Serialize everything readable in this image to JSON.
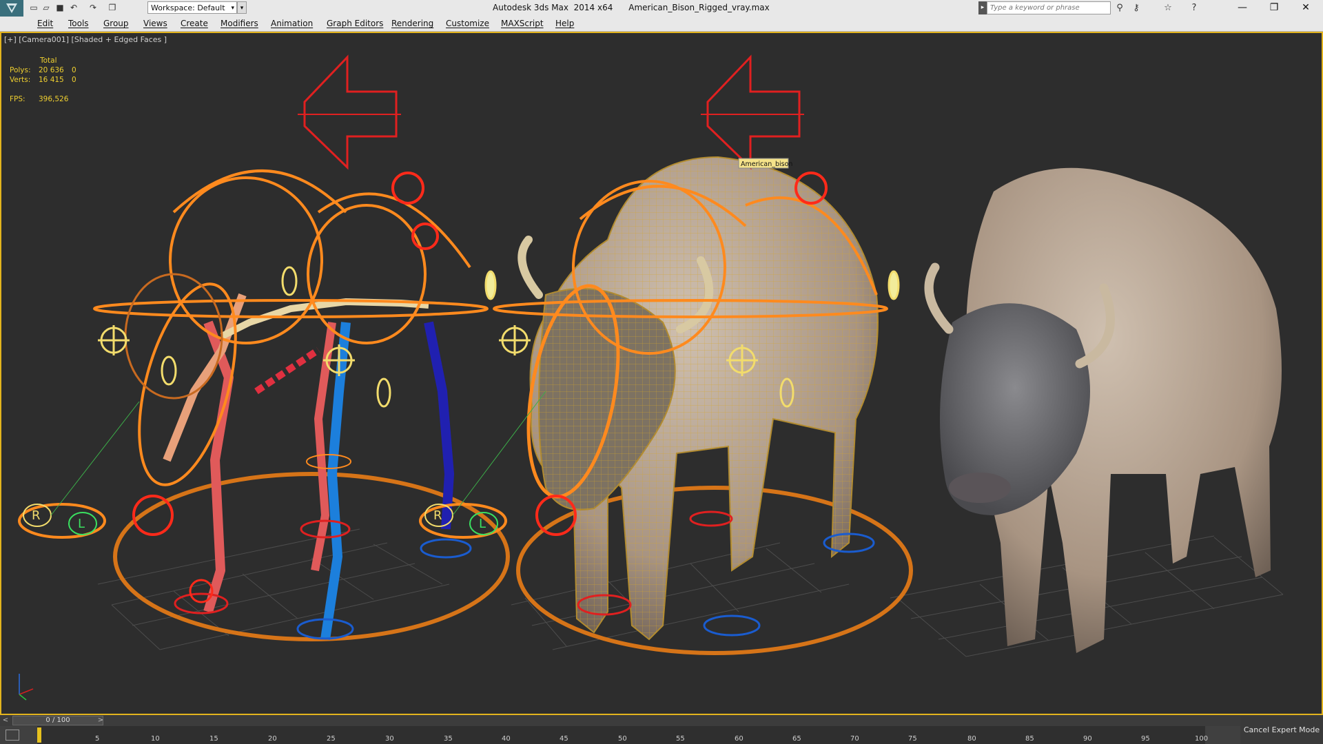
{
  "titlebar": {
    "app_name": "Autodesk 3ds Max  2014 x64",
    "file_name": "American_Bison_Rigged_vray.max",
    "workspace_label": "Workspace: Default",
    "search_placeholder": "Type a keyword or phrase",
    "quick_access_icons": [
      "new-file-icon",
      "open-folder-icon",
      "save-icon",
      "undo-icon",
      "redo-icon",
      "project-folder-icon"
    ],
    "tool_icons": [
      "binoculars-icon",
      "key-icon",
      "star-icon",
      "help-icon"
    ],
    "window_controls": [
      "minimize-icon",
      "restore-icon",
      "close-icon"
    ]
  },
  "menu": {
    "items": [
      "Edit",
      "Tools",
      "Group",
      "Views",
      "Create",
      "Modifiers",
      "Animation",
      "Graph Editors",
      "Rendering",
      "Customize",
      "MAXScript",
      "Help"
    ]
  },
  "viewport": {
    "label": "[+] [Camera001] [Shaded + Edged Faces ]",
    "stats": {
      "header": "Total",
      "polys_label": "Polys:",
      "polys_total": "20 636",
      "polys_sel": "0",
      "verts_label": "Verts:",
      "verts_total": "16 415",
      "verts_sel": "0",
      "fps_label": "FPS:",
      "fps_value": "396,526"
    },
    "tooltip": "American_bison",
    "controls": [
      "R",
      "L",
      "R",
      "L"
    ]
  },
  "timeline": {
    "slider_text": "0 / 100",
    "ticks": [
      "5",
      "10",
      "15",
      "20",
      "25",
      "30",
      "35",
      "40",
      "45",
      "50",
      "55",
      "60",
      "65",
      "70",
      "75",
      "80",
      "85",
      "90",
      "95",
      "100"
    ],
    "cancel_expert": "Cancel Expert Mode"
  },
  "colors": {
    "accent_orange": "#ff8a1e",
    "viewport_border": "#e3b41d",
    "stats_yellow": "#f0d030",
    "biped_red": "#e03030",
    "biped_blue": "#1a74d8"
  }
}
